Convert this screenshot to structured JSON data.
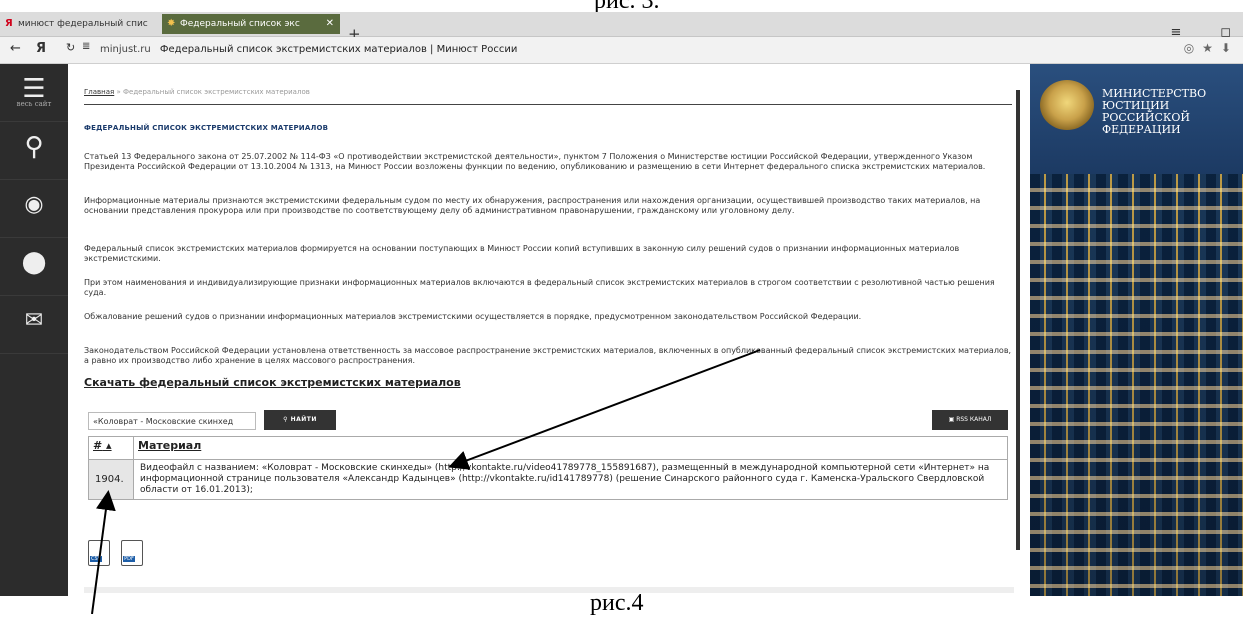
{
  "captions": {
    "top": "рис. 3.",
    "bottom": "рис.4"
  },
  "browser": {
    "tabs": [
      {
        "label": "минюст федеральный спис"
      },
      {
        "label": "Федеральный список экс"
      }
    ],
    "new_tab": "+",
    "url_host": "minjust.ru",
    "url_title": "Федеральный список экстремистских материалов | Минюст России",
    "window_controls": "≡ _ ◻"
  },
  "sidebar": {
    "items": [
      {
        "label": "весь сайт",
        "icon": "menu-icon"
      },
      {
        "label": "",
        "icon": "search-icon"
      },
      {
        "label": "",
        "icon": "eye-icon"
      },
      {
        "label": "",
        "icon": "map-pin-icon"
      },
      {
        "label": "",
        "icon": "mail-icon"
      }
    ]
  },
  "breadcrumb": {
    "home": "Главная",
    "sep": " » ",
    "current": "Федеральный список экстремистских материалов"
  },
  "page_title": "ФЕДЕРАЛЬНЫЙ СПИСОК ЭКСТРЕМИСТСКИХ МАТЕРИАЛОВ",
  "paragraphs": [
    "Статьей 13 Федерального закона от 25.07.2002 № 114-ФЗ «О противодействии экстремистской деятельности», пунктом 7 Положения о Министерстве юстиции Российской Федерации, утвержденного Указом Президента Российской Федерации от 13.10.2004 № 1313, на Минюст России возложены функции по ведению, опубликованию и размещению в сети Интернет федерального списка экстремистских материалов.",
    "Информационные материалы признаются экстремистскими федеральным судом по месту их обнаружения, распространения или нахождения организации, осуществившей производство таких материалов, на основании представления прокурора или при производстве по соответствующему делу об административном правонарушении, гражданскому или уголовному делу.",
    "Федеральный список экстремистских материалов формируется на основании поступающих в Минюст России копий вступивших в законную силу решений судов о признании информационных материалов экстремистскими.",
    "При этом наименования и индивидуализирующие признаки информационных материалов включаются в федеральный список экстремистских материалов в строгом соответствии с резолютивной частью решения суда.",
    "Обжалование решений судов о признании информационных материалов экстремистскими осуществляется в порядке, предусмотренном законодательством Российской Федерации.",
    "Законодательством Российской Федерации установлена ответственность за массовое распространение экстремистских материалов, включенных в опубликованный федеральный список экстремистских материалов, а равно их производство либо хранение в целях массового распространения."
  ],
  "download_link": "Скачать федеральный список экстремистских материалов",
  "search": {
    "value": "«Коловрат - Московские скинхед",
    "button": "НАЙТИ",
    "rss": "RSS КАНАЛ"
  },
  "table": {
    "headers": [
      "#",
      "Материал"
    ],
    "rows": [
      {
        "num": "1904.",
        "text": "Видеофайл с названием: «Коловрат - Московские скинхеды» (http://vkontakte.ru/video41789778_155891687), размещенный в международной компьютерной сети «Интернет» на информационной странице пользователя «Александр Кадынцев» (http://vkontakte.ru/id141789778) (решение Синарского районного суда г. Каменска-Уральского Свердловской области от 16.01.2013);"
      }
    ]
  },
  "file_icons": [
    "CSV",
    "PDF"
  ],
  "ministry_banner": "МИНИСТЕРСТВО ЮСТИЦИИ РОССИЙСКОЙ ФЕДЕРАЦИИ"
}
